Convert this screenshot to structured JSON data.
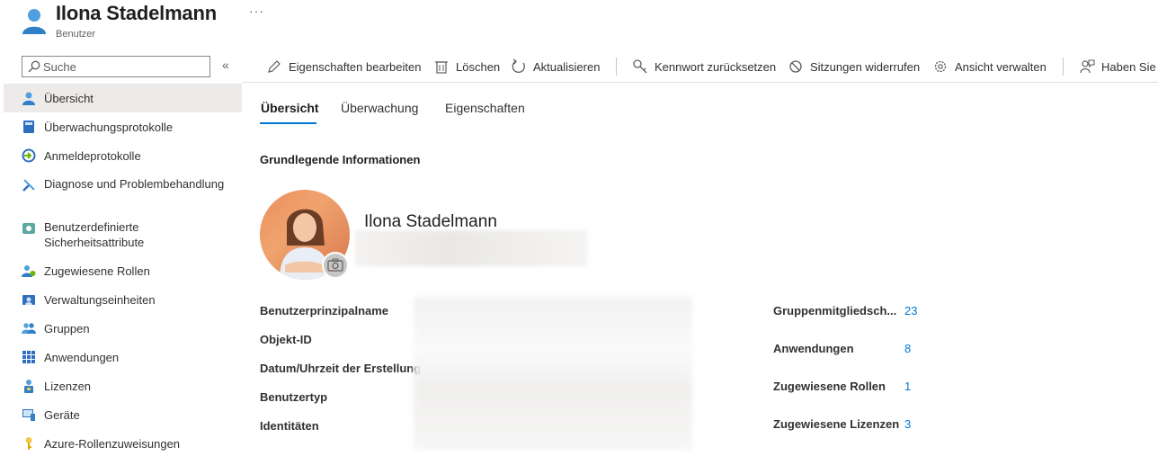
{
  "header": {
    "title": "Ilona Stadelmann",
    "subtitle": "Benutzer",
    "more": "···"
  },
  "sidebar": {
    "search_placeholder": "Suche",
    "collapse": "«",
    "items": [
      {
        "label": "Übersicht",
        "icon": "user-icon"
      },
      {
        "label": "Überwachungsprotokolle",
        "icon": "book-icon"
      },
      {
        "label": "Anmeldeprotokolle",
        "icon": "sign-in-icon"
      },
      {
        "label": "Diagnose und Problembehandlung",
        "icon": "wrench-icon"
      },
      {
        "label": "Benutzerdefinierte Sicherheitsattribute",
        "icon": "attribute-icon"
      },
      {
        "label": "Zugewiesene Rollen",
        "icon": "roles-icon"
      },
      {
        "label": "Verwaltungseinheiten",
        "icon": "admin-units-icon"
      },
      {
        "label": "Gruppen",
        "icon": "groups-icon"
      },
      {
        "label": "Anwendungen",
        "icon": "apps-grid-icon"
      },
      {
        "label": "Lizenzen",
        "icon": "license-icon"
      },
      {
        "label": "Geräte",
        "icon": "devices-icon"
      },
      {
        "label": "Azure-Rollenzuweisungen",
        "icon": "key-icon"
      }
    ]
  },
  "toolbar": {
    "edit": "Eigenschaften bearbeiten",
    "delete": "Löschen",
    "refresh": "Aktualisieren",
    "reset_password": "Kennwort zurücksetzen",
    "revoke_sessions": "Sitzungen widerrufen",
    "manage_view": "Ansicht verwalten",
    "feedback": "Haben Sie"
  },
  "tabs": [
    "Übersicht",
    "Überwachung",
    "Eigenschaften"
  ],
  "main": {
    "section_title": "Grundlegende Informationen",
    "profile_name": "Ilona Stadelmann",
    "properties": [
      "Benutzerprinzipalname",
      "Objekt-ID",
      "Datum/Uhrzeit der Erstellung",
      "Benutzertyp",
      "Identitäten"
    ],
    "stats": [
      {
        "label": "Gruppenmitgliedsch...",
        "value": "23"
      },
      {
        "label": "Anwendungen",
        "value": "8"
      },
      {
        "label": "Zugewiesene Rollen",
        "value": "1"
      },
      {
        "label": "Zugewiesene Lizenzen",
        "value": "3"
      }
    ]
  },
  "colors": {
    "accent": "#0078d4",
    "active_nav": "#edebe9",
    "text": "#323130"
  }
}
